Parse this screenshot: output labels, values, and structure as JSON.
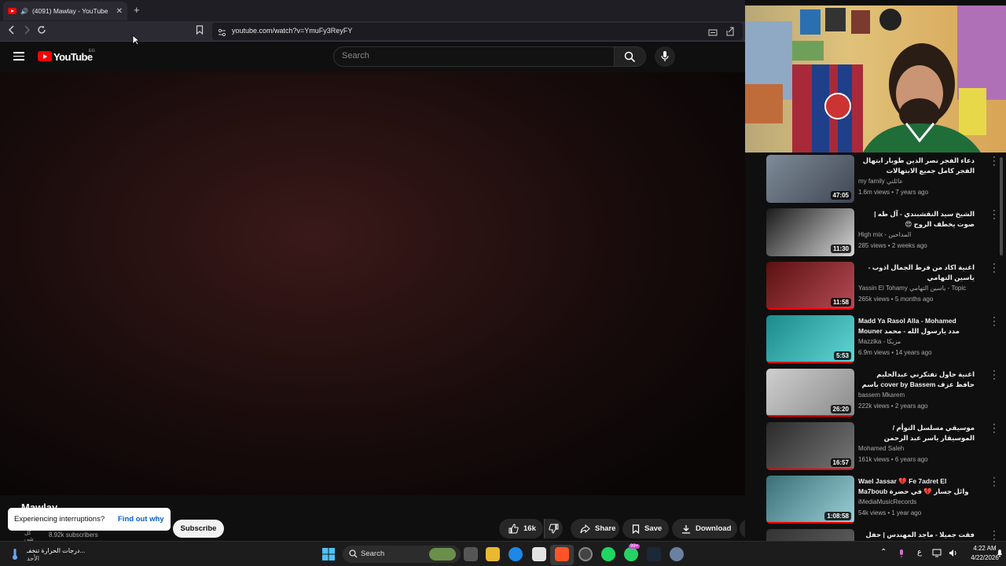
{
  "browser": {
    "tab_title": "(4091) Mawlay - YouTube",
    "new_tab": "+",
    "close_tab": "✕",
    "url": "youtube.com/watch?v=YmuFy3ReyFY"
  },
  "youtube": {
    "logo_text": "YouTube",
    "country_code": "EG",
    "search_placeholder": "Search"
  },
  "video": {
    "title": "Mawlay",
    "subscribers": "8.92k subscribers",
    "subscribe_label": "Subscribe",
    "like_count": "16k",
    "share_label": "Share",
    "save_label": "Save",
    "download_label": "Download"
  },
  "toast": {
    "message": "Experiencing interruptions?",
    "link": "Find out why"
  },
  "recommendations": [
    {
      "title": "دعاء الفجر نصر الدين طوبار ابتهال الفجر كامل جميع الابتهالات وتحفيظ قرآن بسهولة",
      "channel": "my family عائلتي",
      "views": "1.6m views",
      "age": "7 years ago",
      "duration": "47:05",
      "progress": 0.0,
      "colors": [
        "#7f8b99",
        "#3f4652"
      ]
    },
    {
      "title": "الشيخ سيد النقشبندي - آل طه | صوت يخطف الروح 😍",
      "channel": "High mix - المداحين",
      "views": "285 views",
      "age": "2 weeks ago",
      "duration": "11:30",
      "progress": 0.0,
      "colors": [
        "#1a1a1a",
        "#d8d8d8"
      ]
    },
    {
      "title": "اغنية اكاد من فرط الجمال اذوب - ياسين التهامي",
      "channel": "Yassin El Tohamy ياسين التهامي - Topic",
      "views": "265k views",
      "age": "5 months ago",
      "duration": "11:58",
      "progress": 1.0,
      "colors": [
        "#5a1111",
        "#b74b55"
      ]
    },
    {
      "title": "Madd Ya Rasol Alla - Mohamed Mouner مدد يارسول الله - محمد منير",
      "channel": "Mazzika - مزيكا",
      "views": "6.9m views",
      "age": "14 years ago",
      "duration": "5:53",
      "progress": 1.0,
      "colors": [
        "#1a8a8a",
        "#64d6d6"
      ]
    },
    {
      "title": "اغنية حاول تفتكرني عبدالحليم حافظ عزف cover by Bassem باسم مكارم ...",
      "channel": "bassem Mkarem",
      "views": "222k views",
      "age": "2 years ago",
      "duration": "26:20",
      "progress": 1.0,
      "colors": [
        "#cfcfcf",
        "#8a8a8a"
      ]
    },
    {
      "title": "موسيقي مسلسل التوأم / الموسيقار ياسر عبد الرحمن",
      "channel": "Mohamed Saleh",
      "views": "161k views",
      "age": "6 years ago",
      "duration": "16:57",
      "progress": 1.0,
      "colors": [
        "#2b2b2b",
        "#777"
      ]
    },
    {
      "title": "Wael Jassar 💔 Fe 7adret El Ma7boub وائل جسار 💔 في حضرة ...",
      "channel": "iMediaMusicRecords",
      "views": "54k views",
      "age": "1 year ago",
      "duration": "1:08:58",
      "progress": 1.0,
      "colors": [
        "#3a6f78",
        "#9bd0d6"
      ]
    },
    {
      "title": "فقت جميلا - ماجد المهندس | حفل ليلة",
      "channel": "",
      "views": "",
      "age": "",
      "duration": "",
      "progress": 0.0,
      "colors": [
        "#333",
        "#666"
      ]
    }
  ],
  "taskbar": {
    "weather_line1": "درجات الحرارة تنخفـ...",
    "weather_line2": "الأحد",
    "search_label": "Search",
    "notification_badge": "99+",
    "language": "ع",
    "time": "4:22 AM",
    "date": "4/22/2026"
  },
  "colors": {
    "yt_red": "#ff0000",
    "link_blue": "#065fd4",
    "background": "#0f0f0f"
  }
}
